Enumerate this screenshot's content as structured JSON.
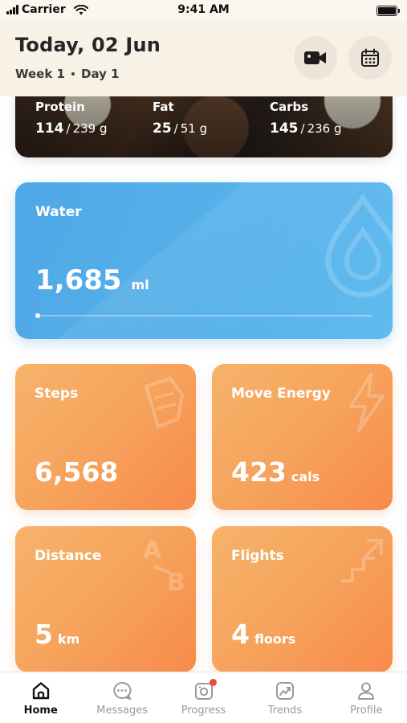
{
  "status_bar": {
    "carrier": "Carrier",
    "time": "9:41 AM"
  },
  "header": {
    "title": "Today, 02 Jun",
    "week": "Week 1",
    "day": "Day 1",
    "video_icon": "video-camera-icon",
    "calendar_icon": "calendar-icon"
  },
  "macros": [
    {
      "label": "Protein",
      "value": "114",
      "total": "239 g"
    },
    {
      "label": "Fat",
      "value": "25",
      "total": "51 g"
    },
    {
      "label": "Carbs",
      "value": "145",
      "total": "236 g"
    }
  ],
  "water": {
    "label": "Water",
    "value": "1,685",
    "unit": "ml",
    "progress": 0.01
  },
  "cards": {
    "steps": {
      "label": "Steps",
      "value": "6,568",
      "unit": ""
    },
    "move": {
      "label": "Move Energy",
      "value": "423",
      "unit": "cals"
    },
    "distance": {
      "label": "Distance",
      "value": "5",
      "unit": "km"
    },
    "flights": {
      "label": "Flights",
      "value": "4",
      "unit": "floors"
    }
  },
  "tabs": [
    {
      "label": "Home",
      "icon": "home-icon",
      "active": true
    },
    {
      "label": "Messages",
      "icon": "chat-icon",
      "active": false
    },
    {
      "label": "Progress",
      "icon": "camera-progress-icon",
      "active": false,
      "badge": true
    },
    {
      "label": "Trends",
      "icon": "trend-chart-icon",
      "active": false
    },
    {
      "label": "Profile",
      "icon": "person-icon",
      "active": false
    }
  ],
  "colors": {
    "water": "#56b1ea",
    "orange": "#f6a35c",
    "badge": "#e94b3c",
    "header_bg": "#f8f1e6"
  }
}
